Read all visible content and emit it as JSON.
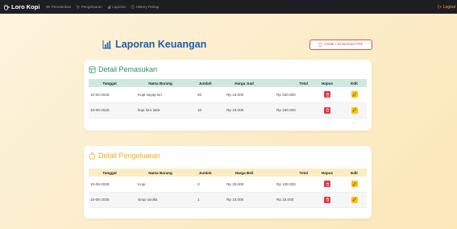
{
  "navbar": {
    "brand": "Loro Kopi",
    "items": [
      {
        "label": "Pemasukan",
        "icon": "cash-icon"
      },
      {
        "label": "Pengeluaran",
        "icon": "cart-icon"
      },
      {
        "label": "Laporan",
        "icon": "bar-chart-icon"
      },
      {
        "label": "History Rekap",
        "icon": "history-icon"
      }
    ],
    "logout": "Logout"
  },
  "header": {
    "title": "Laporan Keuangan",
    "print_button": "Cetak / Download PDF"
  },
  "colors": {
    "title": "#1f5fa8",
    "income_accent": "#2f8f5b",
    "expense_accent": "#f0ad1d",
    "delete_button": "#dc3545",
    "edit_button": "#ffc107"
  },
  "income": {
    "title": "Detail Pemasukan",
    "columns": [
      "Tanggal",
      "Nama Barang",
      "Jumlah",
      "Harga Jual",
      "Total",
      "Hapus",
      "Edit"
    ],
    "rows": [
      {
        "date": "10-06-2025",
        "name": "Kopi sayap kiri",
        "qty": "20",
        "price": "Rp 16.000",
        "total": "Rp 320.000"
      },
      {
        "date": "10-06-2025",
        "name": "kopi loro latte",
        "qty": "10",
        "price": "Rp 16.000",
        "total": "Rp 160.000"
      }
    ]
  },
  "expense": {
    "title": "Detail Pengeluaran",
    "columns": [
      "Tanggal",
      "Nama Barang",
      "Jumlah",
      "Harga Beli",
      "Total",
      "Hapus",
      "Edit"
    ],
    "rows": [
      {
        "date": "10-06-2025",
        "name": "Kopi",
        "qty": "3",
        "price": "Rp 35.000",
        "total": "Rp 105.000"
      },
      {
        "date": "10-06-2025",
        "name": "sirup vanilla",
        "qty": "1",
        "price": "Rp 15.000",
        "total": "Rp 15.000"
      }
    ]
  }
}
